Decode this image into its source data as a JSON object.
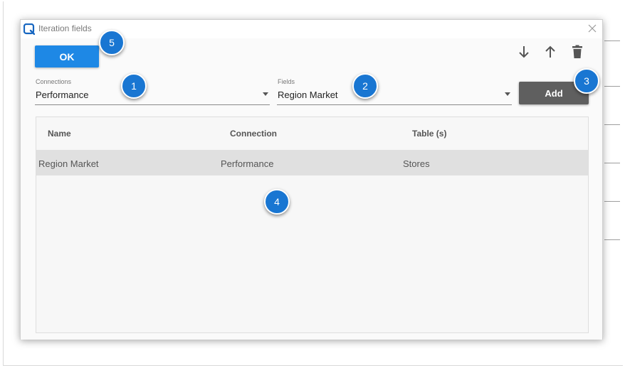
{
  "dialog": {
    "title": "Iteration fields",
    "ok_label": "OK",
    "add_label": "Add"
  },
  "toolbar": {
    "icons": [
      "arrow-down-icon",
      "arrow-up-icon",
      "trash-icon"
    ]
  },
  "connections": {
    "label": "Connections",
    "value": "Performance"
  },
  "fields": {
    "label": "Fields",
    "value": "Region Market"
  },
  "table": {
    "columns": [
      "Name",
      "Connection",
      "Table (s)"
    ],
    "rows": [
      {
        "name": "Region Market",
        "connection": "Performance",
        "table": "Stores"
      }
    ]
  },
  "annotations": [
    "1",
    "2",
    "3",
    "4",
    "5"
  ],
  "colors": {
    "accent": "#1e88e5",
    "marker": "#1976d2",
    "add_button": "#5f5f5f",
    "selected_row": "#e0e0e0"
  }
}
